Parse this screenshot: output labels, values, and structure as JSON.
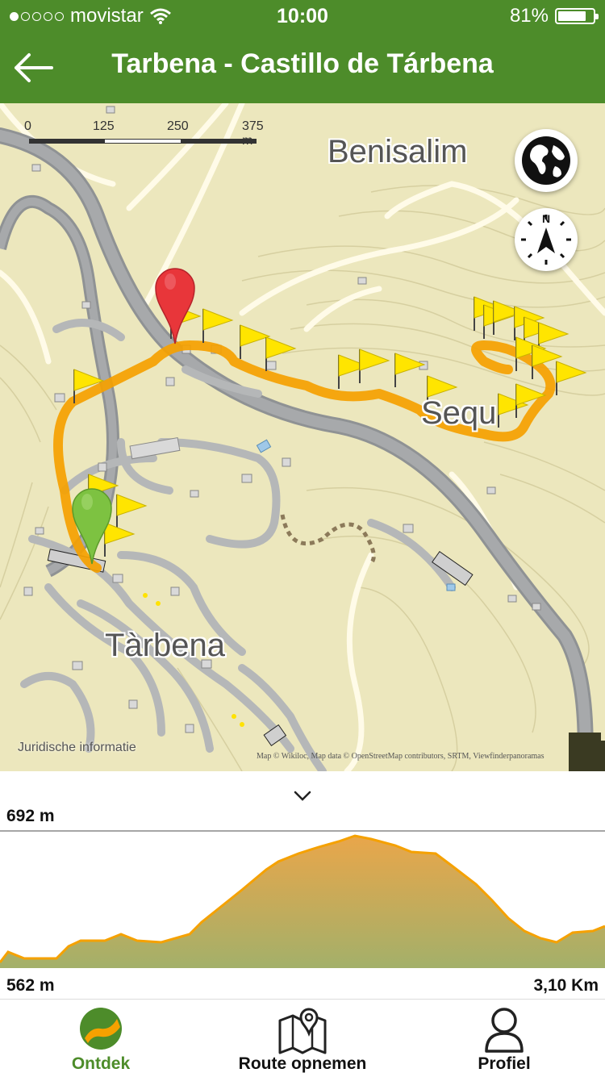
{
  "status_bar": {
    "carrier": "movistar",
    "time": "10:00",
    "battery": "81%",
    "battery_level": 0.81,
    "signal_bars": 1
  },
  "header": {
    "title": "Tarbena - Castillo de Tárbena",
    "back_icon": "arrow-left-icon"
  },
  "map": {
    "scale_labels": [
      "0",
      "125",
      "250",
      "375 m"
    ],
    "place_labels": {
      "north": "Benisalim",
      "east": "Sequ",
      "south": "Tàrbena"
    },
    "legal_link": "Juridische informatie",
    "attribution": "Map © Wikiloc, Map data © OpenStreetMap contributors, SRTM, Viewfinderpanoramas",
    "buttons": [
      {
        "name": "map-layers-button",
        "icon": "globe-icon"
      },
      {
        "name": "compass-button",
        "icon": "compass-icon",
        "label": "N"
      }
    ],
    "route_color": "#f5a100",
    "start_marker_color": "#7dc241",
    "end_marker_color": "#e8363a"
  },
  "elevation": {
    "max_label": "692 m",
    "min_label": "562 m",
    "distance_label": "3,10 Km",
    "collapse_icon": "chevron-down-icon"
  },
  "tabs": [
    {
      "label": "Ontdek",
      "icon": "wikiloc-logo-icon",
      "active": true
    },
    {
      "label": "Route opnemen",
      "icon": "map-pin-icon",
      "active": false
    },
    {
      "label": "Profiel",
      "icon": "user-icon",
      "active": false
    }
  ],
  "colors": {
    "brand_green": "#4d8c2a",
    "route_orange": "#f5a100"
  }
}
